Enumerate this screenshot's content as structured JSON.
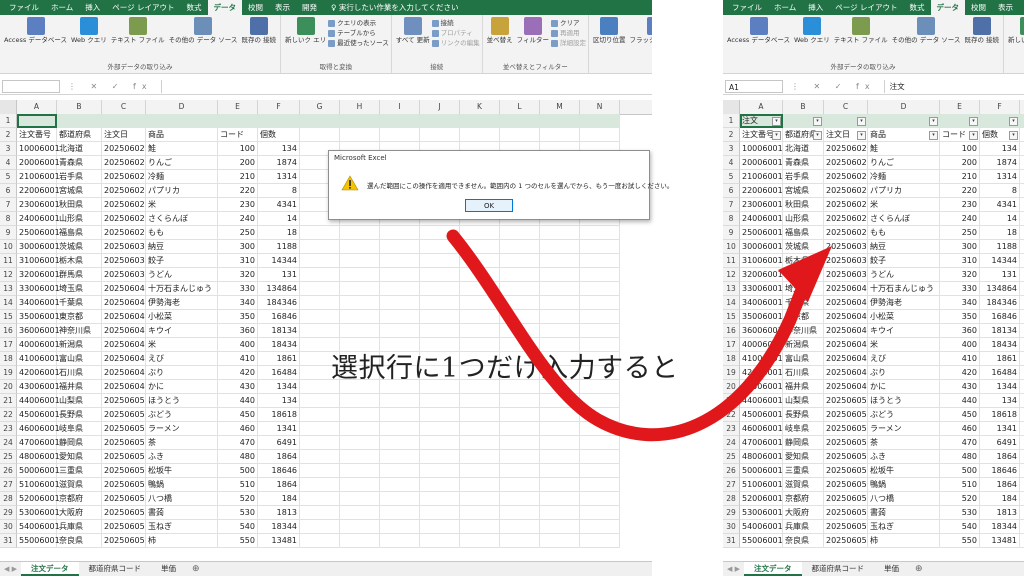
{
  "caption": "選択行に1つだけ入力すると",
  "ribbon": {
    "tabs": [
      "ファイル",
      "ホーム",
      "挿入",
      "ページ レイアウト",
      "数式",
      "データ",
      "校閲",
      "表示",
      "開発"
    ],
    "active_tab": "データ",
    "tell_me": "実行したい作業を入力してください",
    "groups": {
      "external": {
        "label": "外部データの取り込み",
        "buttons": [
          "Access データベース",
          "Web クエリ",
          "テキスト ファイル",
          "その他の データ ソース",
          "既存の 接続"
        ]
      },
      "transform": {
        "label": "取得と変換",
        "buttons": [
          "新しいク エリ"
        ],
        "small": [
          "クエリの表示",
          "テーブルから",
          "最近使ったソース"
        ]
      },
      "connections": {
        "label": "接続",
        "buttons": [
          "すべて 更新"
        ],
        "small": [
          "接続",
          "プロパティ",
          "リンクの編集"
        ]
      },
      "sortfilter": {
        "label": "並べ替えとフィルター",
        "buttons": [
          "並べ替え",
          "フィルター"
        ],
        "small": [
          "クリア",
          "再適用",
          "詳細設定"
        ]
      },
      "datatools": {
        "label": "データ ツール",
        "buttons": [
          "区切り位置",
          "フラッシュ フィル",
          "重複の 削除",
          "データの 入力規則",
          "統合",
          "リレーションシップ"
        ]
      }
    }
  },
  "left": {
    "namebox": "",
    "formula": "",
    "active_sheet": "注文データ"
  },
  "right": {
    "namebox": "A1",
    "formula": "注文",
    "active_sheet": "注文データ"
  },
  "sheets": [
    "注文データ",
    "都道府県コード",
    "単価"
  ],
  "columns": [
    "A",
    "B",
    "C",
    "D",
    "E",
    "F",
    "G",
    "H",
    "I",
    "J",
    "K",
    "L",
    "M",
    "N"
  ],
  "header_row": [
    "注文番号",
    "都道府県",
    "注文日",
    "商品",
    "コード",
    "個数"
  ],
  "right_row1_value": "注文",
  "rows": [
    [
      "10006001",
      "北海道",
      "20250602",
      "鮭",
      "100",
      "134"
    ],
    [
      "20006001",
      "青森県",
      "20250602",
      "りんご",
      "200",
      "1874"
    ],
    [
      "21006001",
      "岩手県",
      "20250602",
      "冷麺",
      "210",
      "1314"
    ],
    [
      "22006001",
      "宮城県",
      "20250602",
      "パプリカ",
      "220",
      "8"
    ],
    [
      "23006001",
      "秋田県",
      "20250602",
      "米",
      "230",
      "4341"
    ],
    [
      "24006001",
      "山形県",
      "20250602",
      "さくらんぼ",
      "240",
      "14"
    ],
    [
      "25006001",
      "福島県",
      "20250602",
      "もも",
      "250",
      "18"
    ],
    [
      "30006001",
      "茨城県",
      "20250603",
      "納豆",
      "300",
      "1188"
    ],
    [
      "31006001",
      "栃木県",
      "20250603",
      "餃子",
      "310",
      "14344"
    ],
    [
      "32006001",
      "群馬県",
      "20250603",
      "うどん",
      "320",
      "131"
    ],
    [
      "33006001",
      "埼玉県",
      "20250604",
      "十万石まんじゅう",
      "330",
      "134864"
    ],
    [
      "34006001",
      "千葉県",
      "20250604",
      "伊勢海老",
      "340",
      "184346"
    ],
    [
      "35006001",
      "東京都",
      "20250604",
      "小松菜",
      "350",
      "16846"
    ],
    [
      "36006001",
      "神奈川県",
      "20250604",
      "キウイ",
      "360",
      "18134"
    ],
    [
      "40006001",
      "新潟県",
      "20250604",
      "米",
      "400",
      "18434"
    ],
    [
      "41006001",
      "富山県",
      "20250604",
      "えび",
      "410",
      "1861"
    ],
    [
      "42006001",
      "石川県",
      "20250604",
      "ぶり",
      "420",
      "16484"
    ],
    [
      "43006001",
      "福井県",
      "20250604",
      "かに",
      "430",
      "1344"
    ],
    [
      "44006001",
      "山梨県",
      "20250605",
      "ほうとう",
      "440",
      "134"
    ],
    [
      "45006001",
      "長野県",
      "20250605",
      "ぶどう",
      "450",
      "18618"
    ],
    [
      "46006001",
      "岐阜県",
      "20250605",
      "ラーメン",
      "460",
      "1341"
    ],
    [
      "47006001",
      "静岡県",
      "20250605",
      "茶",
      "470",
      "6491"
    ],
    [
      "48006001",
      "愛知県",
      "20250605",
      "ふき",
      "480",
      "1864"
    ],
    [
      "50006001",
      "三重県",
      "20250605",
      "松坂牛",
      "500",
      "18646"
    ],
    [
      "51006001",
      "滋賀県",
      "20250605",
      "鴨鍋",
      "510",
      "1864"
    ],
    [
      "52006001",
      "京都府",
      "20250605",
      "八つ橋",
      "520",
      "184"
    ],
    [
      "53006001",
      "大阪府",
      "20250605",
      "書蒟",
      "530",
      "1813"
    ],
    [
      "54006001",
      "兵庫県",
      "20250605",
      "玉ねぎ",
      "540",
      "18344"
    ],
    [
      "55006001",
      "奈良県",
      "20250605",
      "柿",
      "550",
      "13481"
    ]
  ],
  "dialog": {
    "title": "Microsoft Excel",
    "message": "選んだ範囲にこの操作を適用できません。範囲内の 1 つのセルを選んでから、もう一度お試しください。",
    "ok_label": "OK"
  },
  "colors": {
    "excel_green": "#217346",
    "arrow_red": "#e0181b",
    "selection_fill": "#d9e8dd"
  }
}
